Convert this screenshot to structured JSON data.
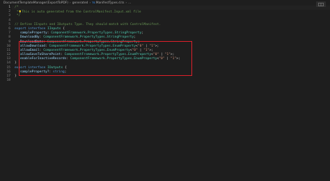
{
  "breadcrumb": {
    "items": [
      "DocumentTemplateManager(ExportToPDF)",
      "generated",
      "ManifestTypes.d.ts",
      "..."
    ]
  },
  "editor": {
    "lines": [
      {
        "n": "1",
        "tokens": [
          {
            "t": "/*",
            "c": "comment"
          }
        ]
      },
      {
        "n": "2",
        "tokens": [
          {
            "t": "*",
            "c": "comment"
          },
          {
            "t": "This is auto generated from the ControlManifest.Input.xml file",
            "c": "comment"
          }
        ]
      },
      {
        "n": "3",
        "tokens": [
          {
            "t": "*/",
            "c": "comment"
          }
        ]
      },
      {
        "n": "4",
        "tokens": []
      },
      {
        "n": "5",
        "tokens": [
          {
            "t": "// Define IInputs and IOutputs Type. They should match with ControlManifest.",
            "c": "comment"
          }
        ]
      },
      {
        "n": "6",
        "tokens": [
          {
            "t": "export",
            "c": "keyword"
          },
          {
            "t": " ",
            "c": "punct"
          },
          {
            "t": "interface",
            "c": "keyword"
          },
          {
            "t": " ",
            "c": "punct"
          },
          {
            "t": "IInputs",
            "c": "type-name"
          },
          {
            "t": " {",
            "c": "punct"
          }
        ]
      },
      {
        "n": "7",
        "tokens": [
          {
            "t": "sampleProperty",
            "c": "prop"
          },
          {
            "t": ": ",
            "c": "punct"
          },
          {
            "t": "ComponentFramework",
            "c": "type-name"
          },
          {
            "t": ".",
            "c": "punct"
          },
          {
            "t": "PropertyTypes",
            "c": "type-name"
          },
          {
            "t": ".",
            "c": "punct"
          },
          {
            "t": "StringProperty",
            "c": "type-name"
          },
          {
            "t": ";",
            "c": "punct"
          }
        ]
      },
      {
        "n": "8",
        "tokens": [
          {
            "t": "DownloadBy",
            "c": "prop"
          },
          {
            "t": ": ",
            "c": "punct"
          },
          {
            "t": "ComponentFramework",
            "c": "type-name"
          },
          {
            "t": ".",
            "c": "punct"
          },
          {
            "t": "PropertyTypes",
            "c": "type-name"
          },
          {
            "t": ".",
            "c": "punct"
          },
          {
            "t": "StringProperty",
            "c": "type-name"
          },
          {
            "t": ";",
            "c": "punct"
          }
        ]
      },
      {
        "n": "9",
        "tokens": [
          {
            "t": "DownloadDate",
            "c": "prop"
          },
          {
            "t": ": ",
            "c": "punct"
          },
          {
            "t": "ComponentFramework",
            "c": "type-name"
          },
          {
            "t": ".",
            "c": "punct"
          },
          {
            "t": "PropertyTypes",
            "c": "type-name"
          },
          {
            "t": ".",
            "c": "punct"
          },
          {
            "t": "StringProperty",
            "c": "type-name"
          },
          {
            "t": ";",
            "c": "punct"
          }
        ]
      },
      {
        "n": "10",
        "tokens": [
          {
            "t": "allowDownload",
            "c": "prop"
          },
          {
            "t": ": ",
            "c": "punct"
          },
          {
            "t": "ComponentFramework",
            "c": "type-name"
          },
          {
            "t": ".",
            "c": "punct"
          },
          {
            "t": "PropertyTypes",
            "c": "type-name"
          },
          {
            "t": ".",
            "c": "punct"
          },
          {
            "t": "EnumProperty",
            "c": "type-name"
          },
          {
            "t": "<",
            "c": "punct"
          },
          {
            "t": "\"0\"",
            "c": "str"
          },
          {
            "t": " | ",
            "c": "punct"
          },
          {
            "t": "\"1\"",
            "c": "str"
          },
          {
            "t": ">;",
            "c": "punct"
          }
        ]
      },
      {
        "n": "11",
        "tokens": [
          {
            "t": "allowEmail",
            "c": "prop"
          },
          {
            "t": ": ",
            "c": "punct"
          },
          {
            "t": "ComponentFramework",
            "c": "type-name"
          },
          {
            "t": ".",
            "c": "punct"
          },
          {
            "t": "PropertyTypes",
            "c": "type-name"
          },
          {
            "t": ".",
            "c": "punct"
          },
          {
            "t": "EnumProperty",
            "c": "type-name"
          },
          {
            "t": "<",
            "c": "punct"
          },
          {
            "t": "\"0\"",
            "c": "str"
          },
          {
            "t": " | ",
            "c": "punct"
          },
          {
            "t": "\"1\"",
            "c": "str"
          },
          {
            "t": ">;",
            "c": "punct"
          }
        ]
      },
      {
        "n": "12",
        "tokens": [
          {
            "t": "allowSaveToSharePoint",
            "c": "prop"
          },
          {
            "t": ": ",
            "c": "punct"
          },
          {
            "t": "ComponentFramework",
            "c": "type-name"
          },
          {
            "t": ".",
            "c": "punct"
          },
          {
            "t": "PropertyTypes",
            "c": "type-name"
          },
          {
            "t": ".",
            "c": "punct"
          },
          {
            "t": "EnumProperty",
            "c": "type-name"
          },
          {
            "t": "<",
            "c": "punct"
          },
          {
            "t": "\"0\"",
            "c": "str"
          },
          {
            "t": " | ",
            "c": "punct"
          },
          {
            "t": "\"1\"",
            "c": "str"
          },
          {
            "t": ">;",
            "c": "punct"
          }
        ]
      },
      {
        "n": "13",
        "tokens": [
          {
            "t": "enableForInactiveRecords",
            "c": "prop"
          },
          {
            "t": ": ",
            "c": "punct"
          },
          {
            "t": "ComponentFramework",
            "c": "type-name"
          },
          {
            "t": ".",
            "c": "punct"
          },
          {
            "t": "PropertyTypes",
            "c": "type-name"
          },
          {
            "t": ".",
            "c": "punct"
          },
          {
            "t": "EnumProperty",
            "c": "type-name"
          },
          {
            "t": "<",
            "c": "punct"
          },
          {
            "t": "\"0\"",
            "c": "str"
          },
          {
            "t": " | ",
            "c": "punct"
          },
          {
            "t": "\"1\"",
            "c": "str"
          },
          {
            "t": ">;",
            "c": "punct"
          }
        ]
      },
      {
        "n": "14",
        "tokens": [
          {
            "t": "}",
            "c": "punct"
          }
        ]
      },
      {
        "n": "15",
        "tokens": [
          {
            "t": "export",
            "c": "keyword"
          },
          {
            "t": " ",
            "c": "punct"
          },
          {
            "t": "interface",
            "c": "keyword"
          },
          {
            "t": " ",
            "c": "punct"
          },
          {
            "t": "IOutputs",
            "c": "type-name"
          },
          {
            "t": " {",
            "c": "punct"
          }
        ]
      },
      {
        "n": "16",
        "tokens": [
          {
            "t": "sampleProperty?",
            "c": "prop"
          },
          {
            "t": ": ",
            "c": "punct"
          },
          {
            "t": "string",
            "c": "keyword"
          },
          {
            "t": ";",
            "c": "punct"
          }
        ]
      },
      {
        "n": "17",
        "tokens": [
          {
            "t": "}",
            "c": "punct"
          }
        ]
      },
      {
        "n": "18",
        "tokens": []
      }
    ]
  },
  "colors": {
    "highlight_border": "#e0202a",
    "background": "#1e1e1e"
  }
}
